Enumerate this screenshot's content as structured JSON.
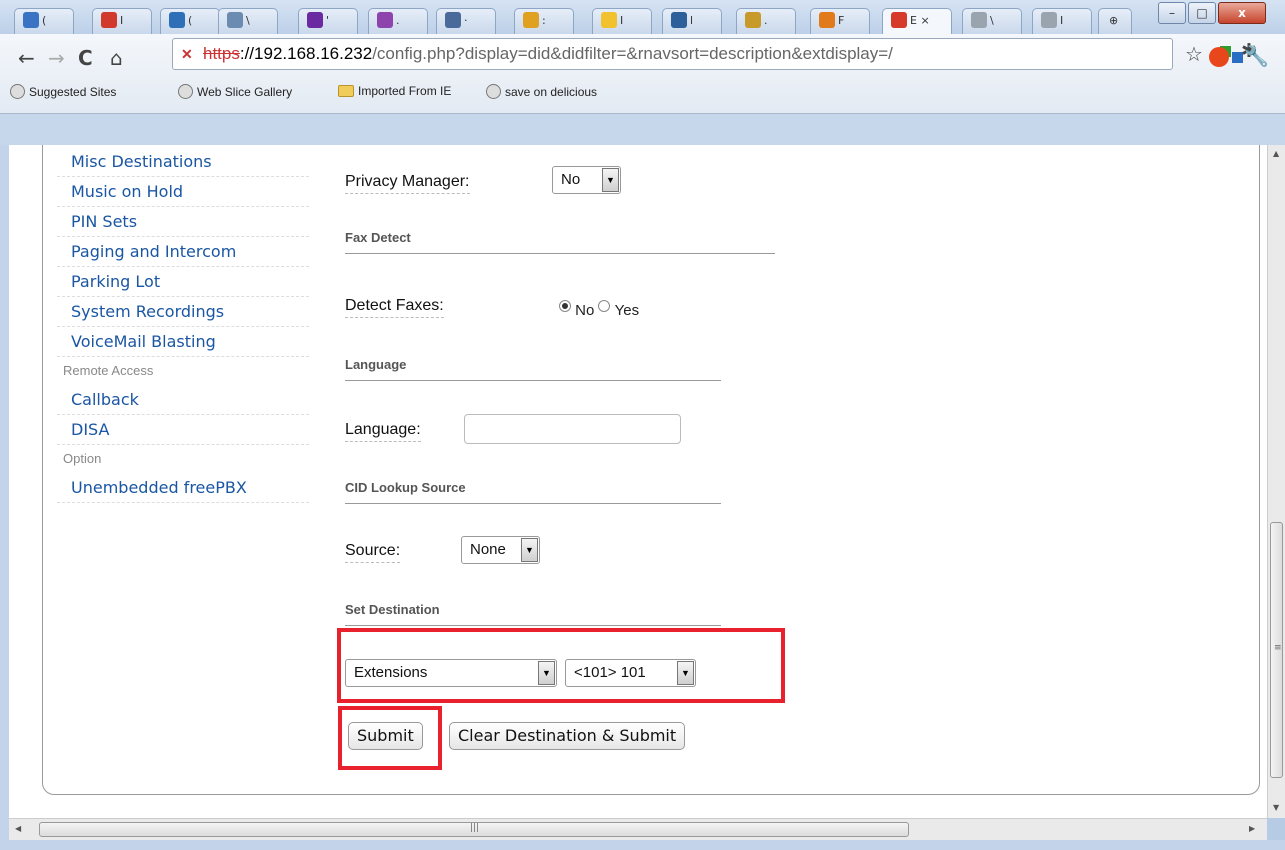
{
  "window": {
    "minimize": "–",
    "maximize": "□",
    "close": "x"
  },
  "tabs": [
    {
      "label": "(",
      "color": "#3b73c4"
    },
    {
      "label": "I",
      "color": "#d0392b"
    },
    {
      "label": "(",
      "color": "#2e6fb8"
    },
    {
      "label": "\\",
      "color": "#6b8cb0"
    },
    {
      "label": "'",
      "color": "#6a2aa1"
    },
    {
      "label": ".",
      "color": "#8e44ad"
    },
    {
      "label": "·",
      "color": "#4a6a9a"
    },
    {
      "label": ":",
      "color": "#e0a020"
    },
    {
      "label": "I",
      "color": "#f2c12e"
    },
    {
      "label": "l",
      "color": "#2d5f9a"
    },
    {
      "label": ".",
      "color": "#c89a2a"
    },
    {
      "label": "F",
      "color": "#e07a1a"
    },
    {
      "label": "E ×",
      "color": "#d63a2a",
      "active": true
    },
    {
      "label": "\\",
      "color": "#9aa4ae"
    },
    {
      "label": "I",
      "color": "#9aa4ae"
    }
  ],
  "address": {
    "scheme": "https",
    "host": "://192.168.16.232",
    "path": "/config.php?display=did&didfilter=&rnavsort=description&extdisplay=/"
  },
  "bookmarks": [
    {
      "label": "Suggested Sites",
      "icon": "globe-icon"
    },
    {
      "label": "Web Slice Gallery",
      "icon": "globe-icon"
    },
    {
      "label": "Imported From IE",
      "icon": "folder-icon"
    },
    {
      "label": "save on delicious",
      "icon": "globe-icon"
    }
  ],
  "sidebar": {
    "items": [
      {
        "type": "link",
        "label": "Misc Destinations"
      },
      {
        "type": "link",
        "label": "Music on Hold"
      },
      {
        "type": "link",
        "label": "PIN Sets"
      },
      {
        "type": "link",
        "label": "Paging and Intercom"
      },
      {
        "type": "link",
        "label": "Parking Lot"
      },
      {
        "type": "link",
        "label": "System Recordings"
      },
      {
        "type": "link",
        "label": "VoiceMail Blasting"
      },
      {
        "type": "head",
        "label": "Remote Access"
      },
      {
        "type": "link",
        "label": "Callback"
      },
      {
        "type": "link",
        "label": "DISA"
      },
      {
        "type": "head",
        "label": "Option"
      },
      {
        "type": "link",
        "label": "Unembedded freePBX"
      }
    ]
  },
  "form": {
    "privacy_label": "Privacy Manager:",
    "privacy_value": "No",
    "fax_section": "Fax Detect",
    "detect_label": "Detect Faxes:",
    "detect_no": "No",
    "detect_yes": "Yes",
    "language_section": "Language",
    "language_label": "Language:",
    "language_value": "",
    "cid_section": "CID Lookup Source",
    "source_label": "Source:",
    "source_value": "None",
    "dest_section": "Set Destination",
    "dest_type": "Extensions",
    "dest_value": "<101> 101",
    "submit": "Submit",
    "clear_submit": "Clear Destination & Submit"
  },
  "colors": {
    "highlight": "#e8212c",
    "link": "#1a56a3"
  }
}
